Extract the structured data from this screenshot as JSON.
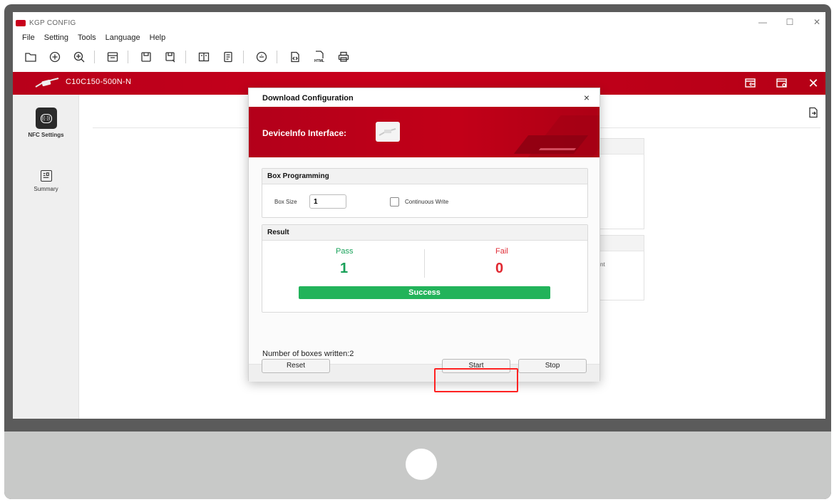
{
  "window": {
    "app_title": "KGP CONFIG"
  },
  "menu": [
    "File",
    "Setting",
    "Tools",
    "Language",
    "Help"
  ],
  "toolbar": {
    "icons": [
      "folder-open-icon",
      "add-circle-icon",
      "add-child-icon",
      "open-config-icon",
      "save-icon",
      "save-as-icon",
      "compare-icon",
      "document-icon",
      "read-device-icon",
      "code-export-icon",
      "html-export-icon",
      "print-icon"
    ],
    "html_label": "HTML"
  },
  "header": {
    "device_name": "C10C150-500N-N"
  },
  "sidebar": {
    "items": [
      {
        "label": "NFC Settings",
        "icon": "nfc-icon"
      },
      {
        "label": "Summary",
        "icon": "summary-icon"
      }
    ]
  },
  "background": {
    "ghost_text_a": "nt"
  },
  "dialog": {
    "title": "Download Configuration",
    "banner_title": "DeviceInfo Interface:",
    "box_programming": {
      "title": "Box Programming",
      "box_size_label": "Box Size",
      "box_size_value": "1",
      "continuous_write_label": "Continuous Write",
      "continuous_write_checked": false
    },
    "result": {
      "title": "Result",
      "pass_label": "Pass",
      "pass_value": "1",
      "fail_label": "Fail",
      "fail_value": "0",
      "status": "Success"
    },
    "boxes_written": "Number of boxes written:2",
    "buttons": {
      "reset": "Reset",
      "start": "Start",
      "stop": "Stop"
    }
  },
  "colors": {
    "brand_red": "#c8001c",
    "pass_green": "#18a058",
    "fail_red": "#e12831",
    "success_bar": "#22b35a",
    "highlight": "#ff2222"
  }
}
